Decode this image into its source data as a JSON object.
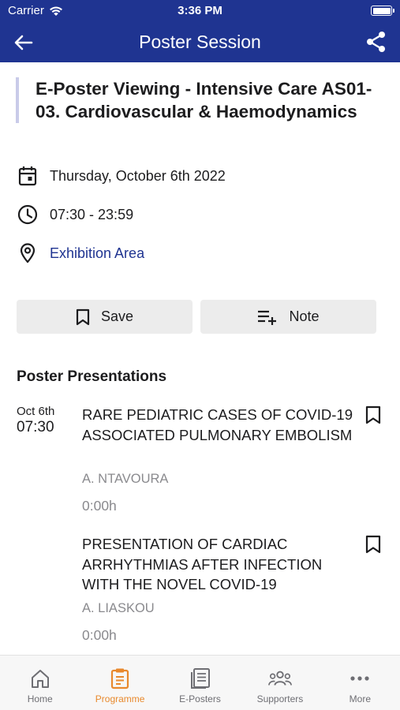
{
  "status_bar": {
    "carrier": "Carrier",
    "time": "3:36 PM"
  },
  "nav": {
    "title": "Poster Session"
  },
  "session": {
    "title": "E-Poster Viewing - Intensive Care AS01-03. Cardiovascular & Haemodynamics",
    "date": "Thursday, October 6th 2022",
    "time_range": "07:30 - 23:59",
    "location": "Exhibition Area"
  },
  "actions": {
    "save_label": "Save",
    "note_label": "Note"
  },
  "presentations_section": {
    "title": "Poster Presentations",
    "items": [
      {
        "date": "Oct 6th",
        "time": "07:30",
        "title": "RARE PEDIATRIC CASES OF COVID-19 ASSOCIATED PULMONARY EMBOLISM",
        "author": "A. NTAVOURA",
        "duration": "0:00h"
      },
      {
        "date": "",
        "time": "",
        "title": "PRESENTATION OF CARDIAC ARRHYTHMIAS AFTER INFECTION WITH THE NOVEL COVID-19",
        "author": "A. LIASKOU",
        "duration": "0:00h"
      }
    ]
  },
  "tabs": [
    {
      "label": "Home",
      "icon": "home-icon",
      "active": false
    },
    {
      "label": "Programme",
      "icon": "clipboard-icon",
      "active": true
    },
    {
      "label": "E-Posters",
      "icon": "document-icon",
      "active": false
    },
    {
      "label": "Supporters",
      "icon": "group-icon",
      "active": false
    },
    {
      "label": "More",
      "icon": "more-icon",
      "active": false
    }
  ],
  "colors": {
    "brand": "#1f3491",
    "accent": "#e8892d",
    "link": "#1f3491",
    "secondary_text": "#8a8a8e"
  }
}
